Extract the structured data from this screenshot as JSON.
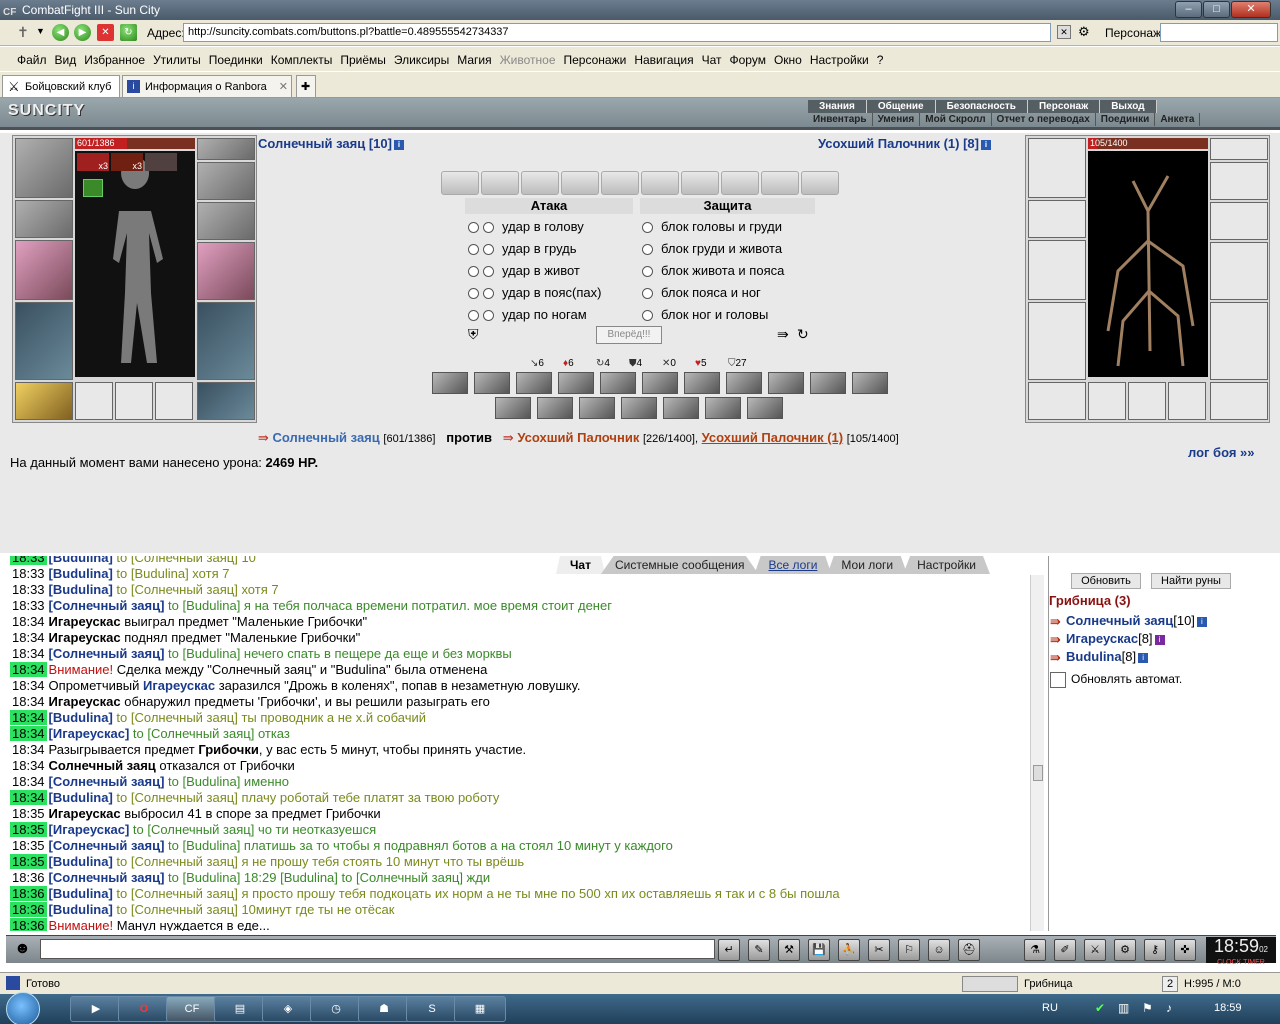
{
  "window": {
    "app_icon": "CF",
    "title": "CombatFight III - Sun City",
    "controls": [
      "–",
      "□",
      "✕"
    ]
  },
  "address_bar": {
    "label": "Адрес:",
    "url": "http://suncity.combats.com/buttons.pl?battle=0.489555542734337",
    "character_label": "Персонаж:",
    "character_value": ""
  },
  "menu": [
    "Файл",
    "Вид",
    "Избранное",
    "Утилиты",
    "Поединки",
    "Комплекты",
    "Приёмы",
    "Эликсиры",
    "Магия",
    "Животное",
    "Персонажи",
    "Навигация",
    "Чат",
    "Форум",
    "Окно",
    "Настройки",
    "?"
  ],
  "menu_disabled": "Животное",
  "tabs": [
    {
      "label": "Бойцовский клуб"
    },
    {
      "label": "Информация о Ranbora"
    }
  ],
  "game_logo": "SUNCITY",
  "game_nav_top": [
    "Знания",
    "Общение",
    "Безопасность",
    "Персонаж",
    "Выход"
  ],
  "game_nav_bottom": [
    "Инвентарь",
    "Умения",
    "Мой Скролл",
    "Отчет о переводах",
    "Поединки",
    "Анкета"
  ],
  "player": {
    "name": "Солнечный заяц [10]",
    "hp": "601/1386",
    "badge1": "x3",
    "badge2": "x3",
    "hp_fraction": 0.434
  },
  "enemy": {
    "name": "Усохший Палочник (1) [8]",
    "hp": "105/1400",
    "hp_fraction": 0.075
  },
  "attack": {
    "title": "Атака",
    "options": [
      "удар в голову",
      "удар в грудь",
      "удар в живот",
      "удар в пояс(пах)",
      "удар по ногам"
    ]
  },
  "defense": {
    "title": "Защита",
    "options": [
      "блок головы и груди",
      "блок груди и живота",
      "блок живота и пояса",
      "блок пояса и ног",
      "блок ног и головы"
    ]
  },
  "forward_button": "Вперёд!!!",
  "stats": [
    "6",
    "6",
    "4",
    "4",
    "0",
    "5",
    "27"
  ],
  "versus": {
    "arrow": "⇛",
    "p1": "Солнечный заяц",
    "p1_hp": "[601/1386]",
    "vs": "против",
    "e1": "Усохший Палочник",
    "e1_hp": "[226/1400],",
    "e2": "Усохший Палочник (1)",
    "e2_hp": "[105/1400]"
  },
  "damage": {
    "text": "На данный момент вами нанесено урона:",
    "value": "2469 HP."
  },
  "battle_log_link": "лог боя »»",
  "chat_tabs": [
    "Чат",
    "Системные сообщения",
    "Все логи",
    "Мои логи",
    "Настройки"
  ],
  "chat": [
    {
      "t": "18:33",
      "hl": true,
      "parts": [
        {
          "c": "c-blue",
          "x": "[Budulina]"
        },
        {
          "c": "c-olive",
          "x": " to [Солнечный заяц] 10"
        }
      ]
    },
    {
      "t": "18:33",
      "hl": false,
      "parts": [
        {
          "c": "c-blue",
          "x": "[Budulina]"
        },
        {
          "c": "c-olive",
          "x": " to [Budulina] хотя 7"
        }
      ]
    },
    {
      "t": "18:33",
      "hl": false,
      "parts": [
        {
          "c": "c-blue",
          "x": "[Budulina]"
        },
        {
          "c": "c-olive",
          "x": " to [Солнечный заяц] хотя 7"
        }
      ]
    },
    {
      "t": "18:33",
      "hl": false,
      "parts": [
        {
          "c": "c-blue",
          "x": "[Солнечный заяц]"
        },
        {
          "c": "c-green",
          "x": " to [Budulina] я на тебя полчаса времени потратил. мое время стоит денег"
        }
      ]
    },
    {
      "t": "18:34",
      "hl": false,
      "parts": [
        {
          "c": "c-bold",
          "x": "Игареускас"
        },
        {
          "c": "",
          "x": " выиграл предмет \"Маленькие Грибочки\""
        }
      ]
    },
    {
      "t": "18:34",
      "hl": false,
      "parts": [
        {
          "c": "c-bold",
          "x": "Игареускас"
        },
        {
          "c": "",
          "x": " поднял предмет \"Маленькие Грибочки\""
        }
      ]
    },
    {
      "t": "18:34",
      "hl": false,
      "parts": [
        {
          "c": "c-blue",
          "x": "[Солнечный заяц]"
        },
        {
          "c": "c-green",
          "x": " to [Budulina] нечего спать в пещере да еще и без морквы"
        }
      ]
    },
    {
      "t": "18:34",
      "hl": true,
      "parts": [
        {
          "c": "c-red",
          "x": "Внимание!"
        },
        {
          "c": "",
          "x": " Сделка между \"Солнечный заяц\" и \"Budulina\" была отменена"
        }
      ]
    },
    {
      "t": "18:34",
      "hl": false,
      "parts": [
        {
          "c": "",
          "x": "Опрометчивый "
        },
        {
          "c": "c-blue",
          "x": "Игареускас"
        },
        {
          "c": "",
          "x": " заразился \"Дрожь в коленях\", попав в незаметную ловушку."
        }
      ]
    },
    {
      "t": "18:34",
      "hl": false,
      "parts": [
        {
          "c": "c-bold",
          "x": "Игареускас"
        },
        {
          "c": "",
          "x": " обнаружил предметы 'Грибочки', и вы решили разыграть его"
        }
      ]
    },
    {
      "t": "18:34",
      "hl": true,
      "parts": [
        {
          "c": "c-blue",
          "x": "[Budulina]"
        },
        {
          "c": "c-olive",
          "x": " to [Солнечный заяц] ты проводник а не х.й собачий"
        }
      ]
    },
    {
      "t": "18:34",
      "hl": true,
      "parts": [
        {
          "c": "c-blue",
          "x": "[Игареускас]"
        },
        {
          "c": "c-green",
          "x": " to [Солнечный заяц] отказ"
        }
      ]
    },
    {
      "t": "18:34",
      "hl": false,
      "parts": [
        {
          "c": "",
          "x": "Разыгрывается предмет "
        },
        {
          "c": "c-bold",
          "x": "Грибочки"
        },
        {
          "c": "",
          "x": ", у вас есть 5 минут, чтобы принять участие."
        }
      ]
    },
    {
      "t": "18:34",
      "hl": false,
      "parts": [
        {
          "c": "c-bold",
          "x": "Солнечный заяц"
        },
        {
          "c": "",
          "x": " отказался от Грибочки"
        }
      ]
    },
    {
      "t": "18:34",
      "hl": false,
      "parts": [
        {
          "c": "c-blue",
          "x": "[Солнечный заяц]"
        },
        {
          "c": "c-green",
          "x": " to [Budulina] именно"
        }
      ]
    },
    {
      "t": "18:34",
      "hl": true,
      "parts": [
        {
          "c": "c-blue",
          "x": "[Budulina]"
        },
        {
          "c": "c-olive",
          "x": " to [Солнечный заяц] плачу роботай тебе платят за твою роботу"
        }
      ]
    },
    {
      "t": "18:35",
      "hl": false,
      "parts": [
        {
          "c": "c-bold",
          "x": "Игареускас"
        },
        {
          "c": "",
          "x": " выбросил 41 в споре за предмет Грибочки"
        }
      ]
    },
    {
      "t": "18:35",
      "hl": true,
      "parts": [
        {
          "c": "c-blue",
          "x": "[Игареускас]"
        },
        {
          "c": "c-green",
          "x": " to [Солнечный заяц] чо ти неотказуешся"
        }
      ]
    },
    {
      "t": "18:35",
      "hl": false,
      "parts": [
        {
          "c": "c-blue",
          "x": "[Солнечный заяц]"
        },
        {
          "c": "c-green",
          "x": " to [Budulina] платишь за то чтобы я подравнял ботов а на стоял 10 минут у каждого"
        }
      ]
    },
    {
      "t": "18:35",
      "hl": true,
      "parts": [
        {
          "c": "c-blue",
          "x": "[Budulina]"
        },
        {
          "c": "c-olive",
          "x": " to [Солнечный заяц] я не прошу тебя стоять 10 минут что ты врёшь"
        }
      ]
    },
    {
      "t": "18:36",
      "hl": false,
      "parts": [
        {
          "c": "c-blue",
          "x": "[Солнечный заяц]"
        },
        {
          "c": "c-green",
          "x": " to [Budulina] 18:29 [Budulina] to [Солнечный заяц] жди"
        }
      ]
    },
    {
      "t": "18:36",
      "hl": true,
      "parts": [
        {
          "c": "c-blue",
          "x": "[Budulina]"
        },
        {
          "c": "c-olive",
          "x": " to [Солнечный заяц] я просто прошу тебя подкоцать их норм а не ты мне по 500 хп их оставляешь я так и с 8 бы пошла"
        }
      ]
    },
    {
      "t": "18:36",
      "hl": true,
      "parts": [
        {
          "c": "c-blue",
          "x": "[Budulina]"
        },
        {
          "c": "c-olive",
          "x": " to [Солнечный заяц] 10минут где ты не отёсак"
        }
      ]
    },
    {
      "t": "18:36",
      "hl": true,
      "parts": [
        {
          "c": "c-red",
          "x": "Внимание!"
        },
        {
          "c": "",
          "x": " Манул нуждается в еде..."
        }
      ]
    }
  ],
  "side": {
    "refresh": "Обновить",
    "find_runes": "Найти руны",
    "location": "Грибница (3)",
    "players": [
      {
        "name": "Солнечный заяц",
        "lvl": "[10]"
      },
      {
        "name": "Игареускас",
        "lvl": "[8]"
      },
      {
        "name": "Budulina",
        "lvl": "[8]"
      }
    ],
    "auto": "Обновлять автомат."
  },
  "clock": {
    "time": "18:59",
    "sec": "02",
    "label": "CLOCK TIMER"
  },
  "status": {
    "ready": "Готово",
    "location": "Грибница",
    "hm": "H:995 / M:0"
  },
  "taskbar": {
    "lang": "RU",
    "time": "18:59"
  }
}
